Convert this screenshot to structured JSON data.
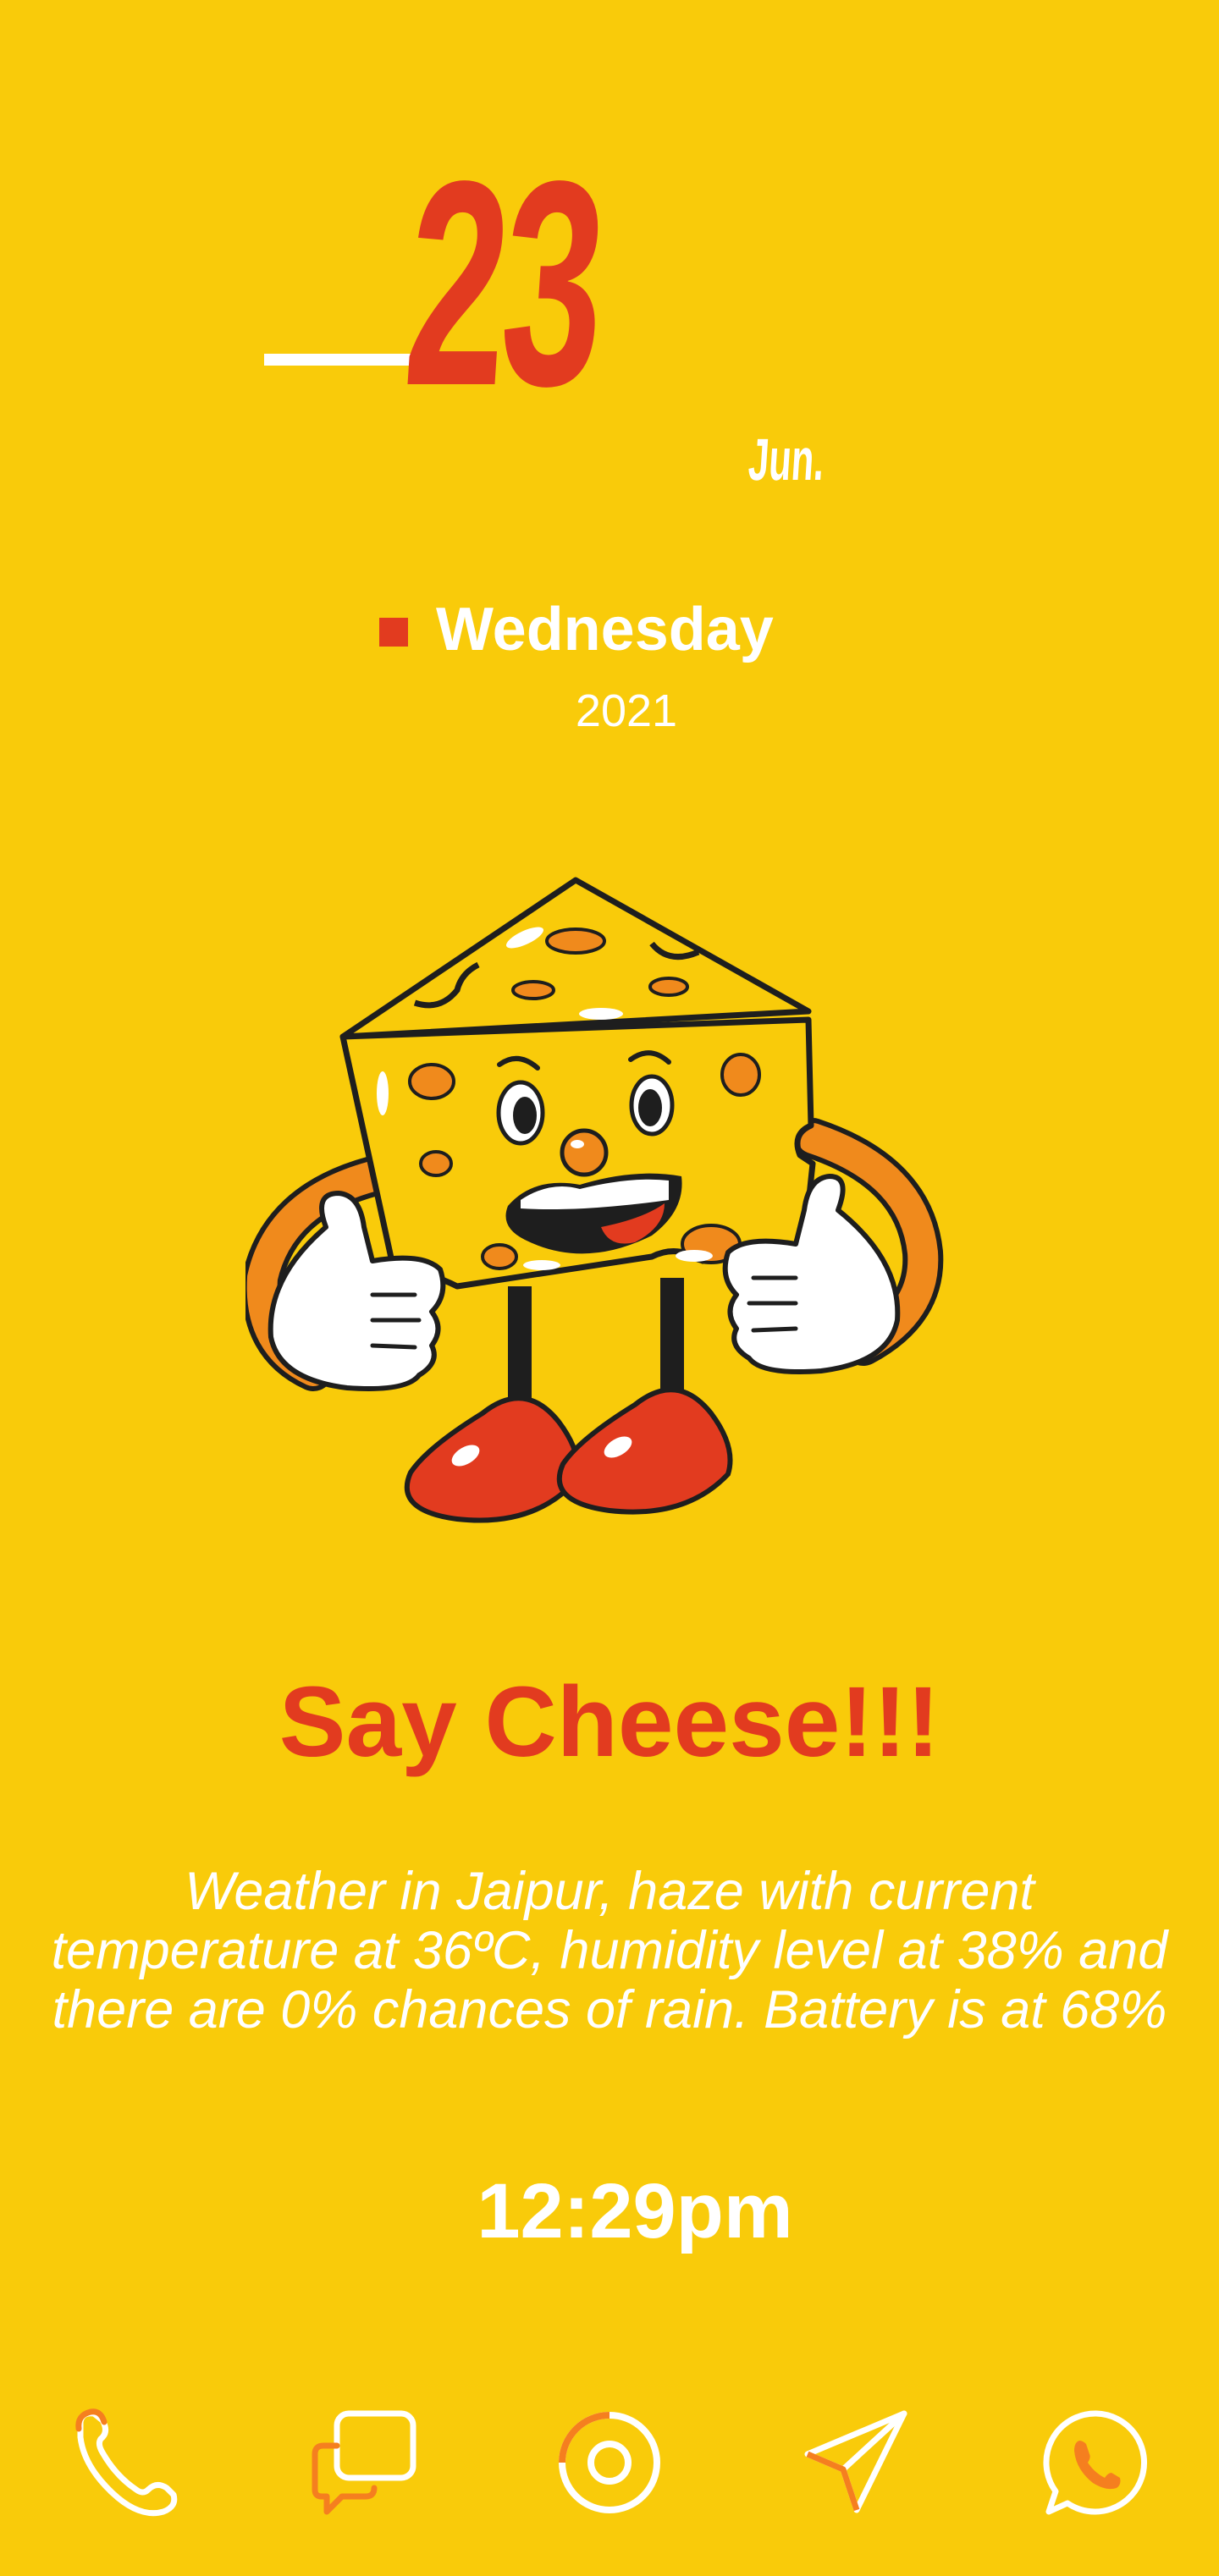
{
  "date": {
    "day": "23",
    "month": "Jun.",
    "weekday": "Wednesday",
    "year": "2021"
  },
  "headline": "Say Cheese!!!",
  "weather_text": "Weather in Jaipur, haze with current temperature at 36ºC, humidity level at 38% and there are 0% chances of rain. Battery is at 68%",
  "clock": "12:29pm",
  "dock": {
    "apps": [
      {
        "icon": "phone-icon"
      },
      {
        "icon": "messages-icon"
      },
      {
        "icon": "camera-icon"
      },
      {
        "icon": "telegram-icon"
      },
      {
        "icon": "whatsapp-icon"
      }
    ]
  },
  "colors": {
    "background": "#F9CB0A",
    "accent_red": "#E23B1F",
    "text_white": "#FFFFFF",
    "icon_orange": "#F57F1F"
  }
}
